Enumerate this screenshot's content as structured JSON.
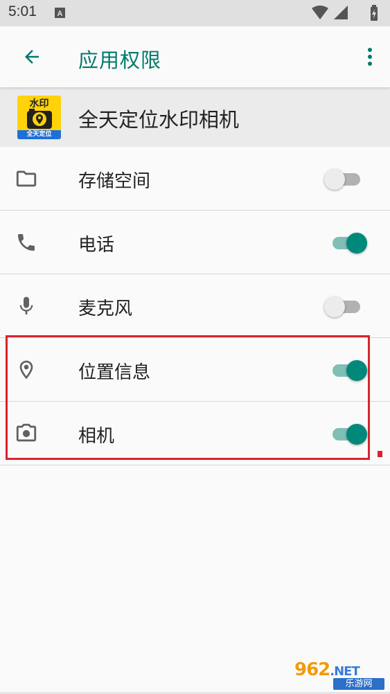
{
  "status_bar": {
    "time": "5:01",
    "icons": [
      "notification-a-icon",
      "wifi-icon",
      "cell-signal-icon",
      "battery-charging-icon"
    ]
  },
  "app_bar": {
    "title": "应用权限",
    "back_icon": "arrow-back-icon",
    "more_icon": "more-vert-icon"
  },
  "app_header": {
    "app_name": "全天定位水印相机",
    "icon_top_text": "水印",
    "icon_bottom_text": "全天定位"
  },
  "permissions": [
    {
      "label": "存储空间",
      "icon": "folder-icon",
      "enabled": false
    },
    {
      "label": "电话",
      "icon": "phone-icon",
      "enabled": true
    },
    {
      "label": "麦克风",
      "icon": "microphone-icon",
      "enabled": false
    },
    {
      "label": "位置信息",
      "icon": "location-pin-icon",
      "enabled": true
    },
    {
      "label": "相机",
      "icon": "camera-icon",
      "enabled": true
    }
  ],
  "watermark": {
    "logo": "962",
    "logo_suffix": ".NET",
    "subtitle": "乐游网"
  },
  "colors": {
    "accent": "#00796b",
    "switch_on_thumb": "#00897b",
    "switch_on_track": "#7fbfb6",
    "switch_off_thumb": "#ececec",
    "switch_off_track": "#b2b2b2",
    "highlight": "#d9232c",
    "app_icon_bg": "#ffd20a"
  }
}
